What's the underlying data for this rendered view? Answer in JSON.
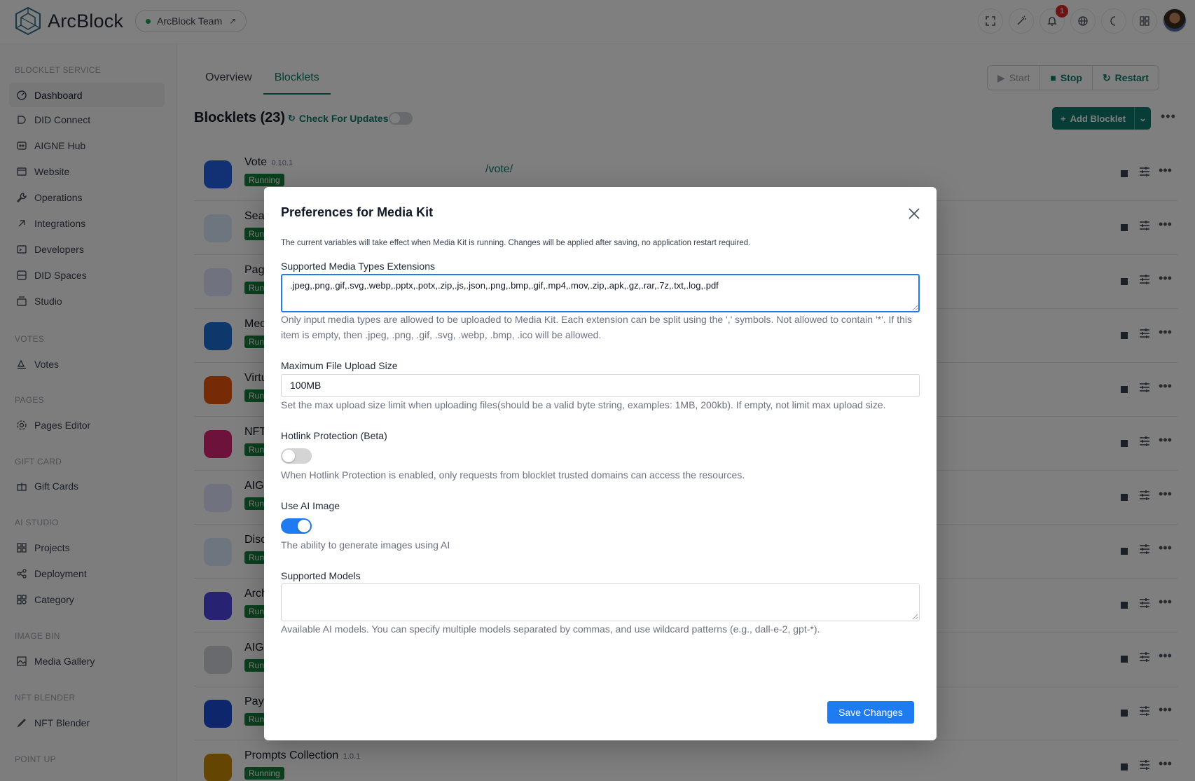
{
  "header": {
    "brand": "ArcBlock",
    "team": "ArcBlock Team",
    "notification_count": "1",
    "icons": [
      "fullscreen-icon",
      "magic-wand-icon",
      "bell-icon",
      "globe-icon",
      "moon-icon",
      "apps-icon"
    ]
  },
  "sidebar": {
    "sections": [
      {
        "title": "BLOCKLET SERVICE",
        "items": [
          {
            "label": "Dashboard",
            "icon": "dashboard-icon",
            "active": true
          },
          {
            "label": "DID Connect",
            "icon": "did-connect-icon"
          },
          {
            "label": "AIGNE Hub",
            "icon": "aigne-hub-icon"
          },
          {
            "label": "Website",
            "icon": "website-icon"
          },
          {
            "label": "Operations",
            "icon": "wrench-icon"
          },
          {
            "label": "Integrations",
            "icon": "integrations-icon"
          },
          {
            "label": "Developers",
            "icon": "terminal-icon"
          },
          {
            "label": "DID Spaces",
            "icon": "database-icon"
          },
          {
            "label": "Studio",
            "icon": "studio-icon"
          }
        ]
      },
      {
        "title": "VOTES",
        "items": [
          {
            "label": "Votes",
            "icon": "vote-icon"
          }
        ]
      },
      {
        "title": "PAGES",
        "items": [
          {
            "label": "Pages Editor",
            "icon": "gear-icon"
          }
        ]
      },
      {
        "title": "GIFT CARD",
        "items": [
          {
            "label": "Gift Cards",
            "icon": "gift-icon"
          }
        ]
      },
      {
        "title": "AI STUDIO",
        "items": [
          {
            "label": "Projects",
            "icon": "grid-icon"
          },
          {
            "label": "Deployment",
            "icon": "share-icon"
          },
          {
            "label": "Category",
            "icon": "category-icon"
          }
        ]
      },
      {
        "title": "IMAGE BIN",
        "items": [
          {
            "label": "Media Gallery",
            "icon": "image-icon"
          }
        ]
      },
      {
        "title": "NFT BLENDER",
        "items": [
          {
            "label": "NFT Blender",
            "icon": "pen-icon"
          }
        ]
      },
      {
        "title": "POINT UP",
        "items": []
      }
    ]
  },
  "main": {
    "tabs": [
      {
        "label": "Overview"
      },
      {
        "label": "Blocklets",
        "active": true
      }
    ],
    "actions": {
      "start": "Start",
      "stop": "Stop",
      "restart": "Restart"
    },
    "title": "Blocklets (23)",
    "check_updates": "Check For Updates",
    "add_blocklet": "Add Blocklet",
    "rows": [
      {
        "name": "Vote",
        "version": "0.10.1",
        "status": "Running",
        "path": "/vote/",
        "color": "#2563eb"
      },
      {
        "name": "Sea",
        "version": "",
        "status": "Runi",
        "path": "",
        "color": "#dbeafe"
      },
      {
        "name": "Pag",
        "version": "",
        "status": "Runi",
        "path": "",
        "color": "#e0e7ff"
      },
      {
        "name": "Med",
        "version": "",
        "status": "Runi",
        "path": "",
        "color": "#1d6fd8"
      },
      {
        "name": "Virtu",
        "version": "",
        "status": "Runi",
        "path": "",
        "color": "#ea580c"
      },
      {
        "name": "NFT",
        "version": "",
        "status": "Runi",
        "path": "",
        "color": "#db2777"
      },
      {
        "name": "AIGI",
        "version": "",
        "status": "Runi",
        "path": "",
        "color": "#e0e7ff"
      },
      {
        "name": "Disc",
        "version": "",
        "status": "Runi",
        "path": "",
        "color": "#dbeafe"
      },
      {
        "name": "Arch",
        "version": "",
        "status": "Runi",
        "path": "",
        "color": "#4f46e5"
      },
      {
        "name": "AIGI",
        "version": "",
        "status": "Runi",
        "path": "",
        "color": "#d1d5db"
      },
      {
        "name": "Payi",
        "version": "",
        "status": "Runi",
        "path": "",
        "color": "#1d4ed8"
      },
      {
        "name": "Prompts Collection",
        "version": "1.0.1",
        "status": "Running",
        "path": "",
        "color": "#ca8a04"
      }
    ]
  },
  "modal": {
    "title": "Preferences for Media Kit",
    "description": "The current variables will take effect when Media Kit is running. Changes will be applied after saving, no application restart required.",
    "media_types": {
      "label": "Supported Media Types Extensions",
      "value": ".jpeg,.png,.gif,.svg,.webp,.pptx,.potx,.zip,.js,.json,.png,.bmp,.gif,.mp4,.mov,.zip,.apk,.gz,.rar,.7z,.txt,.log,.pdf",
      "help": "Only input media types are allowed to be uploaded to Media Kit. Each extension can be split using the ',' symbols. Not allowed to contain '*'. If this item is empty, then .jpeg, .png, .gif, .svg, .webp, .bmp, .ico will be allowed."
    },
    "max_size": {
      "label": "Maximum File Upload Size",
      "value": "100MB",
      "help": "Set the max upload size limit when uploading files(should be a valid byte string, examples: 1MB, 200kb). If empty, not limit max upload size."
    },
    "hotlink": {
      "label": "Hotlink Protection (Beta)",
      "enabled": false,
      "help": "When Hotlink Protection is enabled, only requests from blocklet trusted domains can access the resources."
    },
    "ai_image": {
      "label": "Use AI Image",
      "enabled": true,
      "help": "The ability to generate images using AI"
    },
    "models": {
      "label": "Supported Models",
      "value": "",
      "help": "Available AI models. You can specify multiple models separated by commas, and use wildcard patterns (e.g., dall-e-2, gpt-*)."
    },
    "save_label": "Save Changes"
  }
}
